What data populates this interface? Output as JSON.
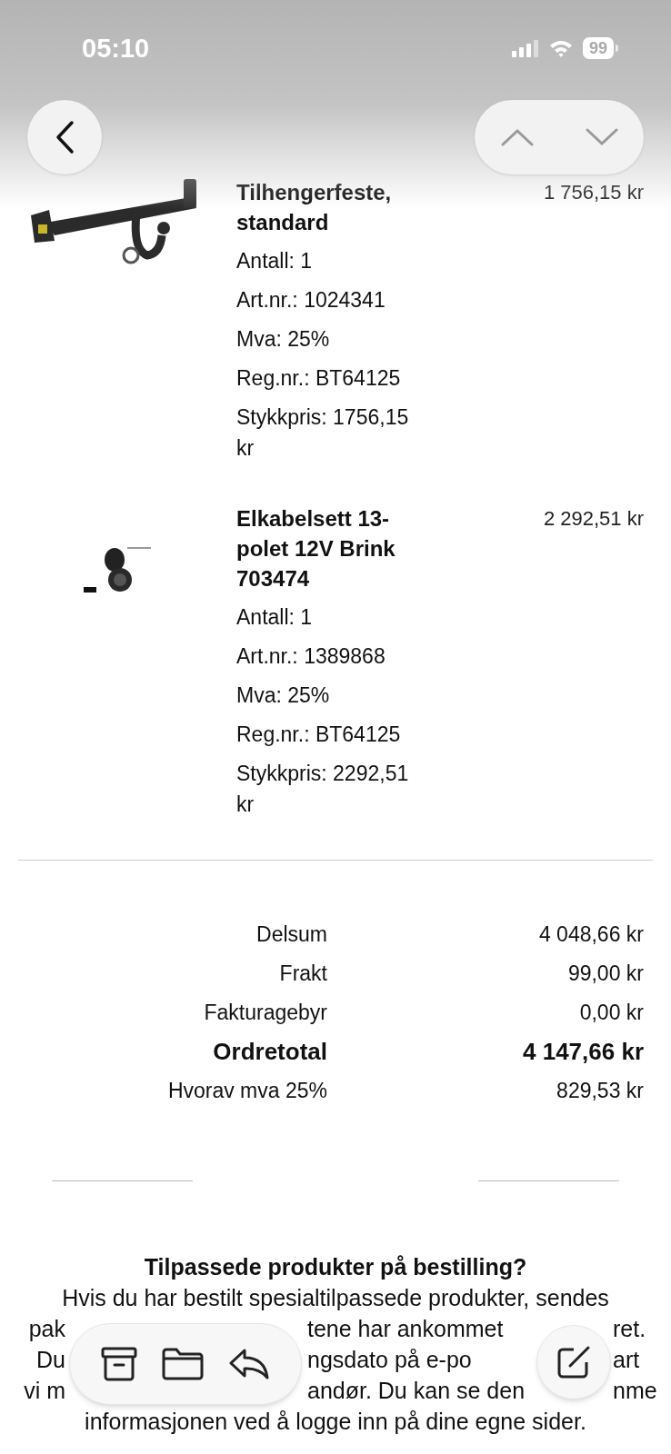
{
  "status_bar": {
    "time": "05:10",
    "battery": "99"
  },
  "items": [
    {
      "title": "Tilhengerfeste, standard",
      "price": "1 756,15 kr",
      "details": [
        "Antall: 1",
        "Art.nr.: 1024341",
        "Mva: 25%",
        "Reg.nr.: BT64125",
        "Stykkpris: 1756,15 kr"
      ]
    },
    {
      "title": "Elkabelsett 13-polet 12V Brink 703474",
      "price": "2 292,51 kr",
      "details": [
        "Antall: 1",
        "Art.nr.: 1389868",
        "Mva: 25%",
        "Reg.nr.: BT64125",
        "Stykkpris: 2292,51 kr"
      ]
    }
  ],
  "totals": [
    {
      "label": "Delsum",
      "value": "4 048,66 kr",
      "emphasized": false
    },
    {
      "label": "Frakt",
      "value": "99,00 kr",
      "emphasized": false
    },
    {
      "label": "Fakturagebyr",
      "value": "0,00 kr",
      "emphasized": false
    },
    {
      "label": "Ordretotal",
      "value": "4 147,66 kr",
      "emphasized": true
    },
    {
      "label": "Hvorav mva 25%",
      "value": "829,53 kr",
      "emphasized": false
    }
  ],
  "notice": {
    "heading": "Tilpassede produkter på bestilling?",
    "lines": [
      [
        "Hvis du har bestilt spesialtilpassede produkter, sendes"
      ],
      [
        "pak",
        "tene har ankommet",
        "ret."
      ],
      [
        "Du",
        "ngsdato på e-po",
        "art"
      ],
      [
        "vi m",
        "andør. Du kan se den",
        "nme"
      ],
      [
        "informasjonen ved å logge inn på dine egne sider."
      ]
    ]
  }
}
